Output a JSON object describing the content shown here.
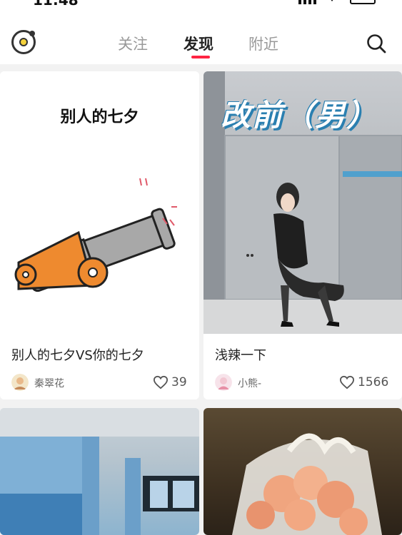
{
  "status_bar": {
    "time": "11:48"
  },
  "nav": {
    "tabs": [
      {
        "label": "关注",
        "active": false
      },
      {
        "label": "发现",
        "active": true
      },
      {
        "label": "附近",
        "active": false
      }
    ],
    "accent_color": "#ff2442",
    "logo_icon": "app-logo-icon",
    "search_icon": "search-icon"
  },
  "feed": {
    "cards": [
      {
        "cover_caption": "别人的七夕",
        "title": "别人的七夕VS你的七夕",
        "author": "秦翠花",
        "likes": "39"
      },
      {
        "cover_caption": "改前（男）",
        "title": "浅辣一下",
        "author": "小熊-",
        "likes": "1566"
      },
      {
        "title": "",
        "author": "",
        "likes": ""
      },
      {
        "title": "",
        "author": "",
        "likes": ""
      }
    ]
  }
}
